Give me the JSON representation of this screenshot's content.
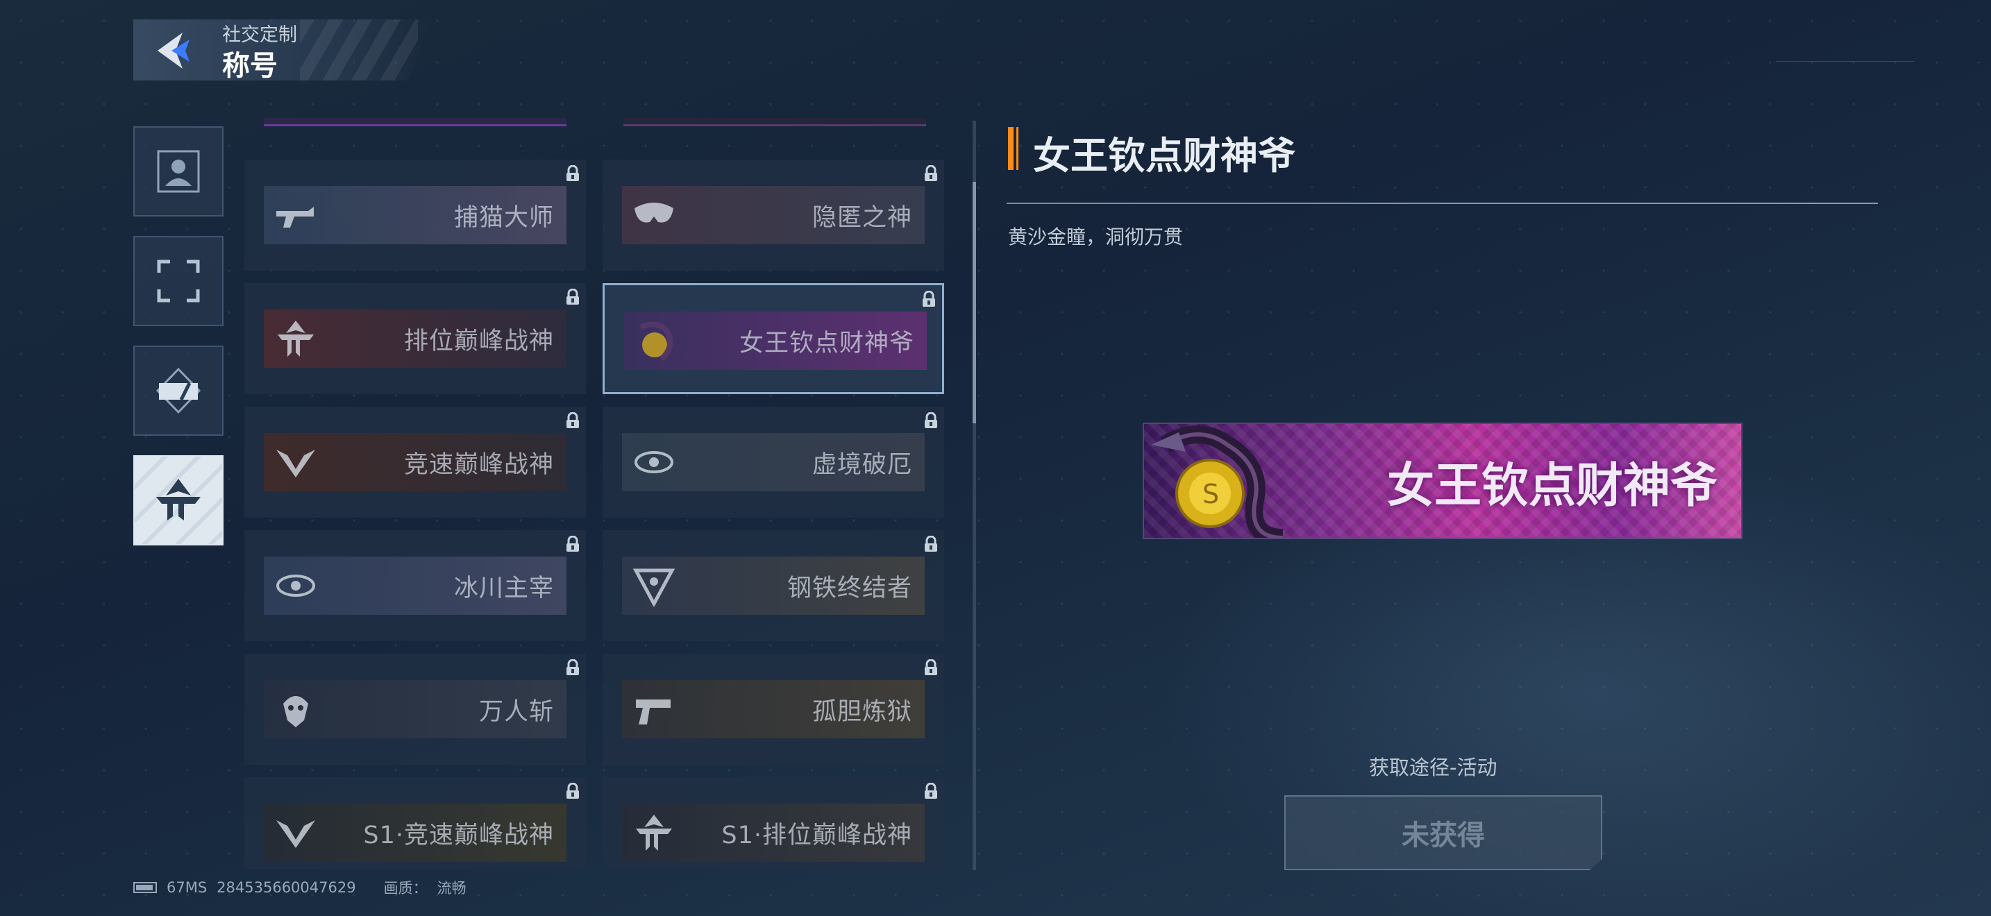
{
  "header": {
    "subtitle": "社交定制",
    "title": "称号"
  },
  "categories": [
    {
      "name": "avatar",
      "active": false
    },
    {
      "name": "frame",
      "active": false
    },
    {
      "name": "bubble",
      "active": false
    },
    {
      "name": "title",
      "active": true
    }
  ],
  "titles": [
    {
      "label": "捕猫大师",
      "emblem": "gun-emblem-icon",
      "art": [
        "#3a4f6a",
        "#6a5a7a"
      ],
      "locked": true,
      "selected": false
    },
    {
      "label": "隐匿之神",
      "emblem": "mask-emblem-icon",
      "art": [
        "#5a3a4a",
        "#4a4a5a"
      ],
      "locked": true,
      "selected": false
    },
    {
      "label": "排位巅峰战神",
      "emblem": "tt-emblem-icon",
      "art": [
        "#6a2a2a",
        "#3a2a3a"
      ],
      "locked": true,
      "selected": false
    },
    {
      "label": "女王钦点财神爷",
      "emblem": "snake-coin-icon",
      "art": [
        "#4a2a6a",
        "#8a2a8a"
      ],
      "locked": true,
      "selected": true
    },
    {
      "label": "竞速巅峰战神",
      "emblem": "v-wing-emblem-icon",
      "art": [
        "#5a2a1a",
        "#3a2a2a"
      ],
      "locked": true,
      "selected": false
    },
    {
      "label": "虚境破厄",
      "emblem": "eye-emblem-icon",
      "art": [
        "#3a4a5a",
        "#4a4a55"
      ],
      "locked": true,
      "selected": false
    },
    {
      "label": "冰川主宰",
      "emblem": "eye-emblem-icon",
      "art": [
        "#3a4a6a",
        "#5a5a7a"
      ],
      "locked": true,
      "selected": false
    },
    {
      "label": "钢铁终结者",
      "emblem": "v-shield-emblem-icon",
      "art": [
        "#3a4055",
        "#5a5040"
      ],
      "locked": true,
      "selected": false
    },
    {
      "label": "万人斩",
      "emblem": "skull-emblem-icon",
      "art": [
        "#2a3040",
        "#404550"
      ],
      "locked": true,
      "selected": false
    },
    {
      "label": "孤胆炼狱",
      "emblem": "pistol-emblem-icon",
      "art": [
        "#3a3530",
        "#5a4a30"
      ],
      "locked": true,
      "selected": false
    },
    {
      "label": "S1·竞速巅峰战神",
      "emblem": "v-wing-emblem-icon",
      "art": [
        "#2a2a2a",
        "#4a4020"
      ],
      "locked": true,
      "selected": false
    },
    {
      "label": "S1·排位巅峰战神",
      "emblem": "tt-emblem-icon",
      "art": [
        "#2a2a30",
        "#4a4035"
      ],
      "locked": true,
      "selected": false
    }
  ],
  "detail": {
    "title": "女王钦点财神爷",
    "description": "黄沙金瞳，洞彻万贯",
    "preview_label": "女王钦点财神爷",
    "acquire_text": "获取途径-活动",
    "status_button": "未获得"
  },
  "footer": {
    "ping": "67MS",
    "uid": "284535660047629",
    "quality_label": "画质：",
    "quality_value": "流畅"
  }
}
